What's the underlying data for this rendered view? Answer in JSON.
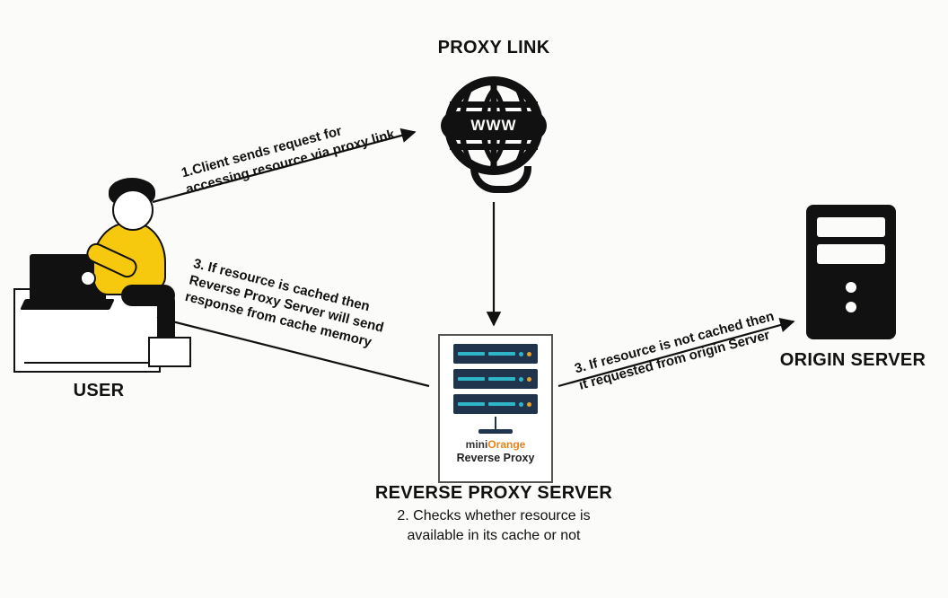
{
  "title_proxy_link": "PROXY LINK",
  "title_user": "USER",
  "title_reverse_proxy": "REVERSE PROXY SERVER",
  "title_origin": "ORIGIN SERVER",
  "globe_band": "WWW",
  "rp_logo_mini": "mini",
  "rp_logo_orange": "Orange",
  "rp_logo_sub": "Reverse Proxy",
  "edge1_l1": "1.Client sends request for",
  "edge1_l2": "accessing resource via proxy link",
  "edge3a_l1": "3. If resource is cached then",
  "edge3a_l2": "Reverse Proxy Server will send",
  "edge3a_l3": "response from cache memory",
  "edge3b_l1": "3. If resource is not cached then",
  "edge3b_l2": "it requested from origin Server",
  "step2_l1": "2. Checks whether resource is",
  "step2_l2": "available in its cache or not"
}
